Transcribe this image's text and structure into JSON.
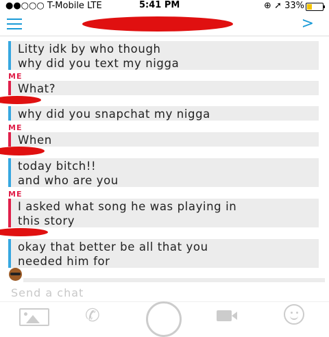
{
  "status_bar": {
    "carrier": "●●○○○ T-Mobile  LTE",
    "time": "5:41 PM",
    "right": "⊕ ➚ 33%",
    "battery_percent": 33
  },
  "header": {
    "chevron": ">"
  },
  "messages": [
    {
      "sender": "them",
      "text": "Litty idk by who though\nwhy did you text my nigga"
    },
    {
      "sender": "me",
      "label": "ME",
      "text": "What?"
    },
    {
      "sender": "them",
      "text": "why did you snapchat my nigga"
    },
    {
      "sender": "me",
      "label": "ME",
      "text": "When"
    },
    {
      "sender": "them",
      "text": "today bitch!!\nand who are you"
    },
    {
      "sender": "me",
      "label": "ME",
      "text": "I asked what song he was playing in\nthis story"
    },
    {
      "sender": "them",
      "text": "okay that better be all that you\nneeded him for"
    }
  ],
  "input": {
    "placeholder": "Send a chat"
  },
  "colors": {
    "accent_blue": "#36a7e0",
    "me_red": "#e0204a",
    "redaction": "#e01010"
  },
  "icons": [
    "menu-icon",
    "chevron-right-icon",
    "photo-icon",
    "phone-icon",
    "camera-shutter-button",
    "video-icon",
    "smiley-icon"
  ]
}
